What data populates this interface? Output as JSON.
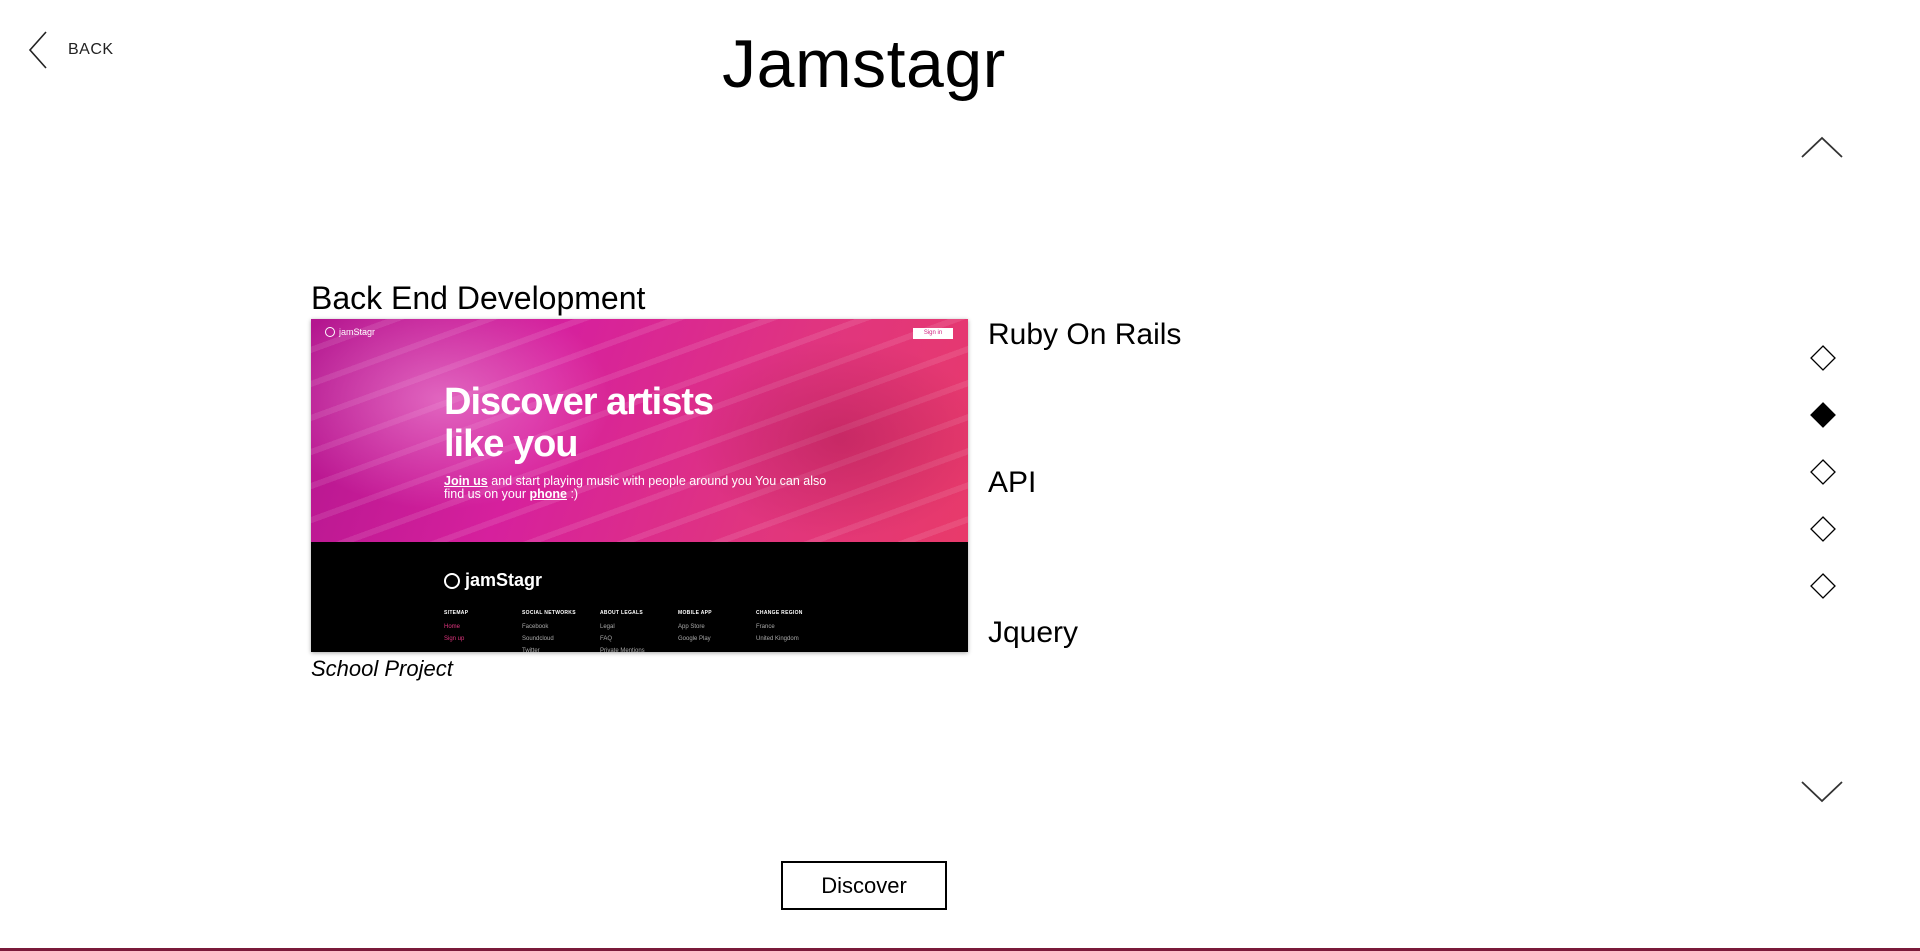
{
  "header": {
    "back_label": "BACK",
    "title": "Jamstagr"
  },
  "icons": {
    "back": "chevron-left-icon",
    "up": "chevron-up-icon",
    "down": "chevron-down-icon",
    "dot": "diamond-icon"
  },
  "nav": {
    "dots": [
      {
        "active": false
      },
      {
        "active": true
      },
      {
        "active": false
      },
      {
        "active": false
      },
      {
        "active": false
      }
    ]
  },
  "section": {
    "title": "Back End Development",
    "caption": "School Project",
    "technologies": [
      "Ruby On Rails",
      "API",
      "Jquery"
    ]
  },
  "preview": {
    "logo": "jamStagr",
    "signin": "Sign in",
    "headline_line1": "Discover artists",
    "headline_line2": "like you",
    "sub_link1": "Join us",
    "sub_text1": " and start playing music with people around you You can also find us on your ",
    "sub_link2": "phone",
    "sub_text2": " :)",
    "footer_logo": "jamStagr",
    "footer_columns": [
      {
        "title": "SITEMAP",
        "items": [
          "Home",
          "Sign up"
        ]
      },
      {
        "title": "SOCIAL NETWORKS",
        "items": [
          "Facebook",
          "Soundcloud",
          "Twitter"
        ]
      },
      {
        "title": "ABOUT LEGALS",
        "items": [
          "Legal",
          "FAQ",
          "Private Mentions"
        ]
      },
      {
        "title": "MOBILE APP",
        "items": [
          "App Store",
          "Google Play"
        ]
      },
      {
        "title": "CHANGE REGION",
        "items": [
          "France",
          "United Kingdom"
        ]
      }
    ]
  },
  "actions": {
    "discover_label": "Discover"
  },
  "colors": {
    "accent_pink": "#e0357f",
    "magenta": "#b3168f",
    "bottom_bar": "#7a1a3a"
  }
}
